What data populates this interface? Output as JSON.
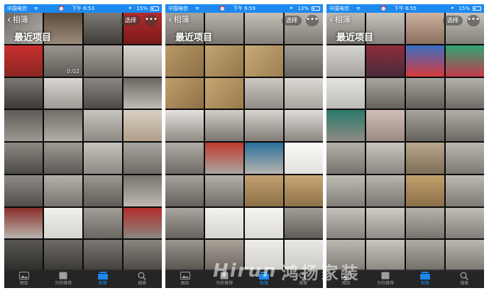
{
  "phones": [
    {
      "status": {
        "carrier": "中国电信",
        "time": "下午 6:53",
        "battery": "15%"
      },
      "nav": {
        "back": "相簿",
        "select": "选择",
        "more": "•••"
      },
      "title": "最近项目",
      "video_duration": "0:02",
      "tabs": [
        "图库",
        "为你推荐",
        "相簿",
        "搜索"
      ]
    },
    {
      "status": {
        "carrier": "中国电信",
        "time": "下午 6:59",
        "battery": "13%"
      },
      "nav": {
        "back": "相簿",
        "select": "选择",
        "more": "•••"
      },
      "title": "最近项目",
      "tabs": [
        "图库",
        "为你推荐",
        "相簿",
        "搜索"
      ]
    },
    {
      "status": {
        "carrier": "中国电信",
        "time": "下午 6:55",
        "battery": "15%"
      },
      "nav": {
        "back": "相簿",
        "select": "选择",
        "more": "•••"
      },
      "title": "最近项目",
      "tabs": [
        "图库",
        "为你推荐",
        "相簿",
        "搜索"
      ]
    }
  ],
  "watermark": {
    "latin": "Hirun",
    "chinese": "鸿扬家装"
  },
  "colors": {
    "accent": "#1c89f0",
    "tab_inactive": "#a0a0a0"
  },
  "icons": {
    "tab_library": "photo-library-icon",
    "tab_for_you": "for-you-icon",
    "tab_albums": "albums-icon",
    "tab_search": "search-icon"
  }
}
